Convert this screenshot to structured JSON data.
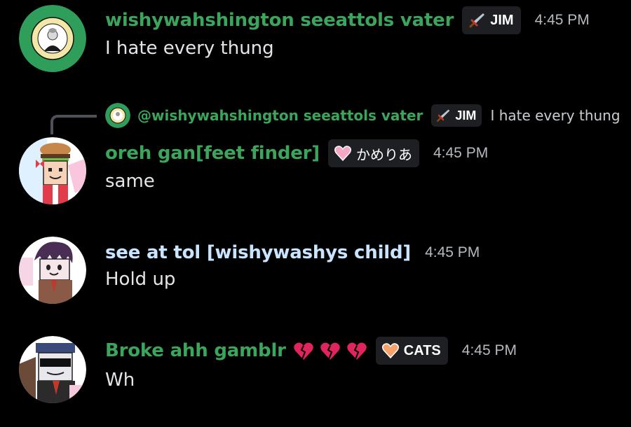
{
  "colors": {
    "background": "#000000",
    "username_green": "#3ba55c",
    "username_blue": "#c9e4ff",
    "tag_bg": "#1e1f22",
    "timestamp": "#b5bac1"
  },
  "messages": [
    {
      "avatar_icon": "washington-state-seal-icon",
      "username": "wishywahshington seeattols vater",
      "tag_icon": "sword-icon",
      "tag": "JIM",
      "time": "4:45 PM",
      "text": "I hate every thung"
    },
    {
      "reply": {
        "avatar_icon": "washington-state-seal-icon",
        "username": "@wishywahshington seeattols vater",
        "tag_icon": "sword-icon",
        "tag": "JIM",
        "text": "I hate every thung"
      },
      "avatar_icon": "burger-character-avatar",
      "username": "oreh gan[feet finder]",
      "tag_icon": "pink-heart-icon",
      "tag": "かめりあ",
      "time": "4:45 PM",
      "text": "same"
    },
    {
      "avatar_icon": "purple-hair-character-avatar",
      "username": "see at tol [wishywashys child]",
      "time": "4:45 PM",
      "text": "Hold up"
    },
    {
      "avatar_icon": "sunglasses-character-avatar",
      "username": "Broke ahh gamblr",
      "username_emoji": [
        "broken-heart-icon",
        "broken-heart-icon",
        "broken-heart-icon"
      ],
      "tag_icon": "orange-heart-icon",
      "tag": "CATS",
      "time": "4:45 PM",
      "text": "Wh"
    }
  ]
}
